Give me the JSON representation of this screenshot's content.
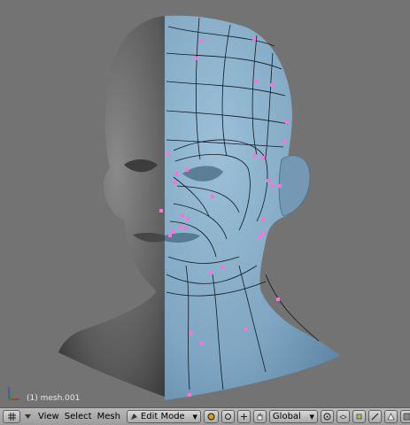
{
  "viewport": {
    "object_label": "(1) mesh.001",
    "background": "#737373",
    "mesh_color": "#7fa6c2",
    "vertex_color": "#ff6fd8"
  },
  "header": {
    "editor_type_icon": "3d-view-grid-icon",
    "menus": [
      "View",
      "Select",
      "Mesh"
    ],
    "mode": "Edit Mode",
    "transform_orientation": "Global",
    "icons": [
      "draw-type-icon",
      "pivot-icon",
      "manipulator-hand-icon",
      "proportional-edit-icon",
      "layer-icon",
      "vertex-select-icon",
      "edge-select-icon",
      "face-select-icon",
      "occlude-icon"
    ]
  }
}
